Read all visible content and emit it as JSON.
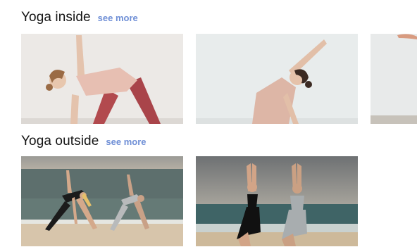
{
  "sections": [
    {
      "title": "Yoga inside",
      "see_more": "see more",
      "items": [
        {
          "label": "Woman in triangle pose indoors",
          "icon": "photo-icon"
        },
        {
          "label": "Woman side stretch indoors",
          "icon": "photo-icon"
        },
        {
          "label": "Indoor yoga photo (partially visible)",
          "icon": "photo-icon"
        }
      ]
    },
    {
      "title": "Yoga outside",
      "see_more": "see more",
      "items": [
        {
          "label": "Two women in triangle pose on the beach",
          "icon": "photo-icon"
        },
        {
          "label": "Two women in tree pose on the beach",
          "icon": "photo-icon"
        }
      ]
    }
  ],
  "colors": {
    "link": "#6f8fd6",
    "indoor_wall": "#e9e6e3",
    "sea": "#5f7273",
    "sand": "#d9c7ae",
    "sky": "#8d8f8f"
  }
}
